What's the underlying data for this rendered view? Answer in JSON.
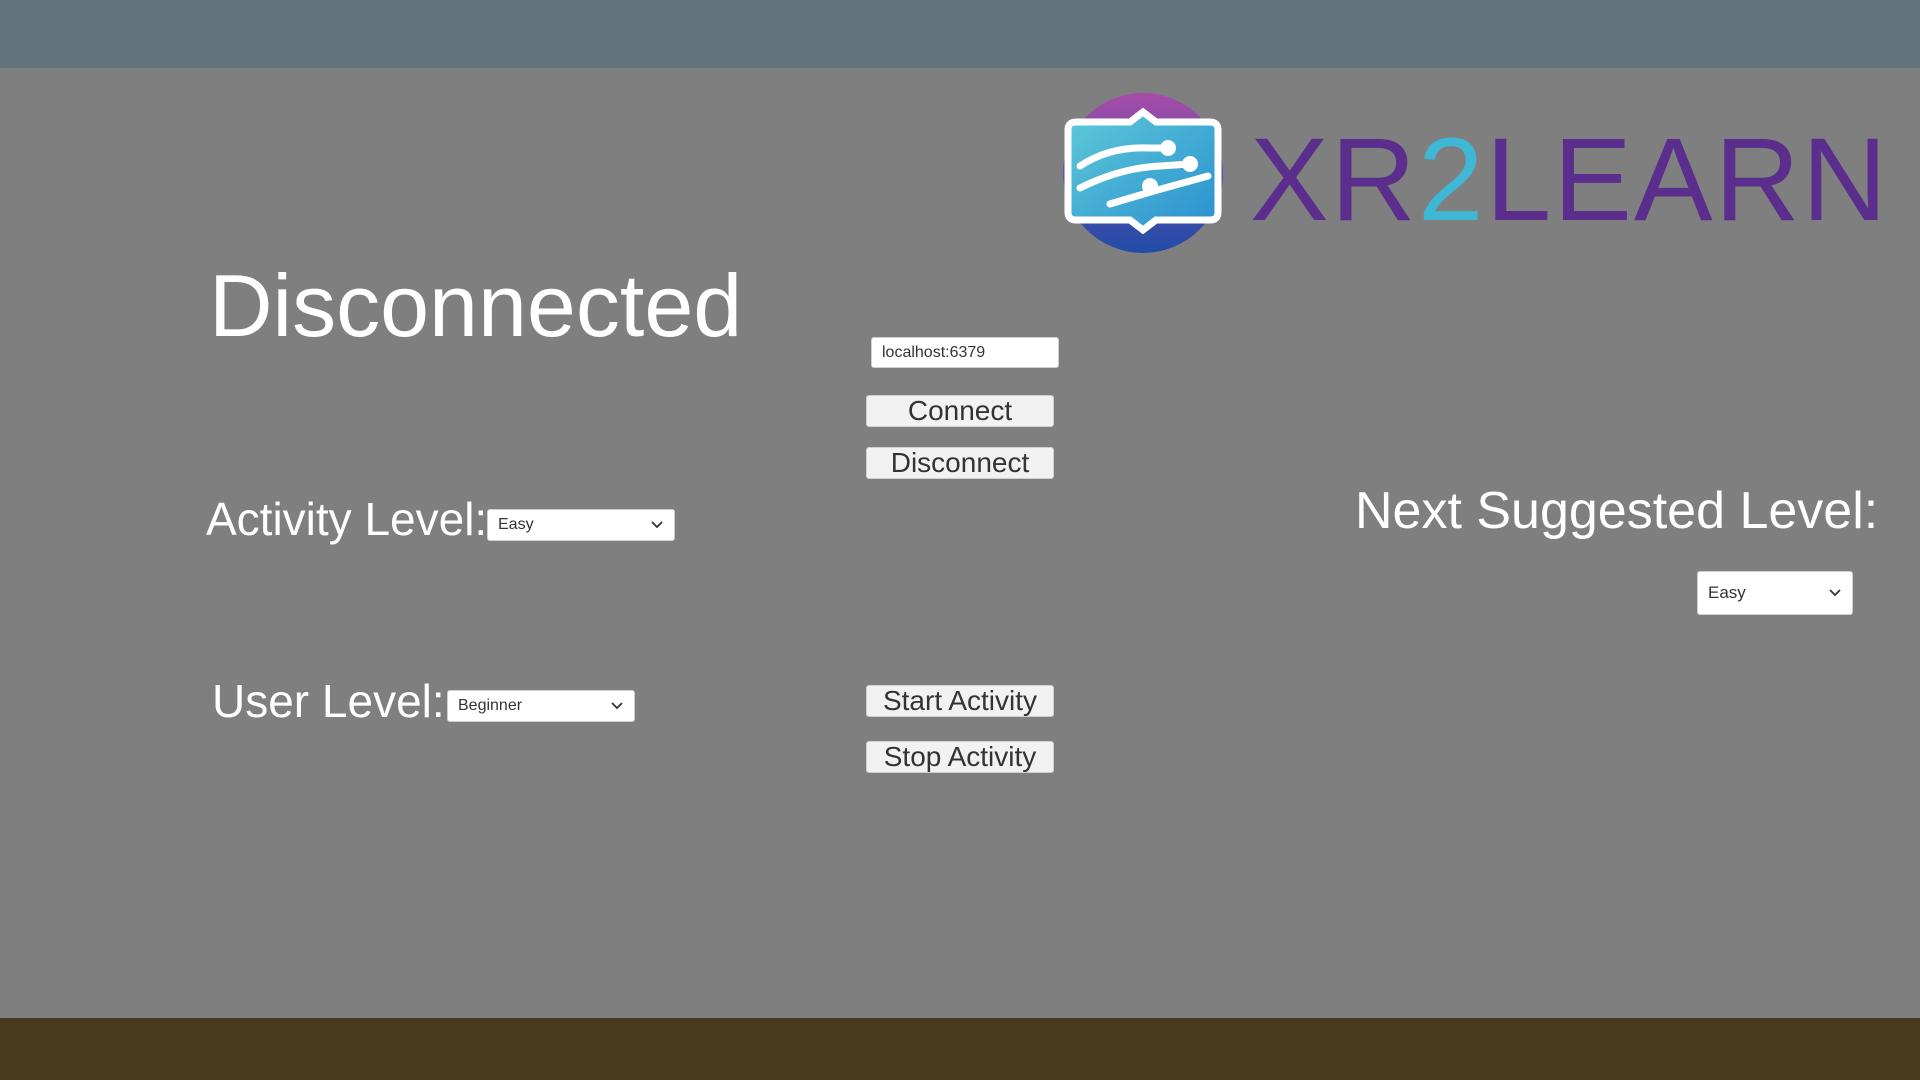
{
  "status": {
    "title": "Disconnected"
  },
  "logo": {
    "text_left": "XR",
    "text_mid": "2",
    "text_right": "LEARN",
    "colors": {
      "wordmark": "#5b2d8c",
      "accent_two": "#3fb8d6",
      "sphere_top": "#a64ca8",
      "sphere_bottom": "#1f4ca8",
      "panel_top": "#5ecad8",
      "panel_bottom": "#2a8fd0"
    }
  },
  "connection": {
    "host_value": "localhost:6379",
    "connect_label": "Connect",
    "disconnect_label": "Disconnect"
  },
  "activity": {
    "label": "Activity Level:",
    "selected": "Easy"
  },
  "user": {
    "label": "User Level:",
    "selected": "Beginner"
  },
  "controls": {
    "start_label": "Start Activity",
    "stop_label": "Stop Activity"
  },
  "suggestion": {
    "label": "Next Suggested Level:",
    "selected": "Easy"
  },
  "icons": {
    "dropdown": "chevron-down-icon",
    "logo": "xr2learn-logo-icon"
  },
  "colors": {
    "background": "#7f7f7f",
    "sky": "#62737e",
    "ground": "#49391f",
    "text": "#ffffff"
  }
}
